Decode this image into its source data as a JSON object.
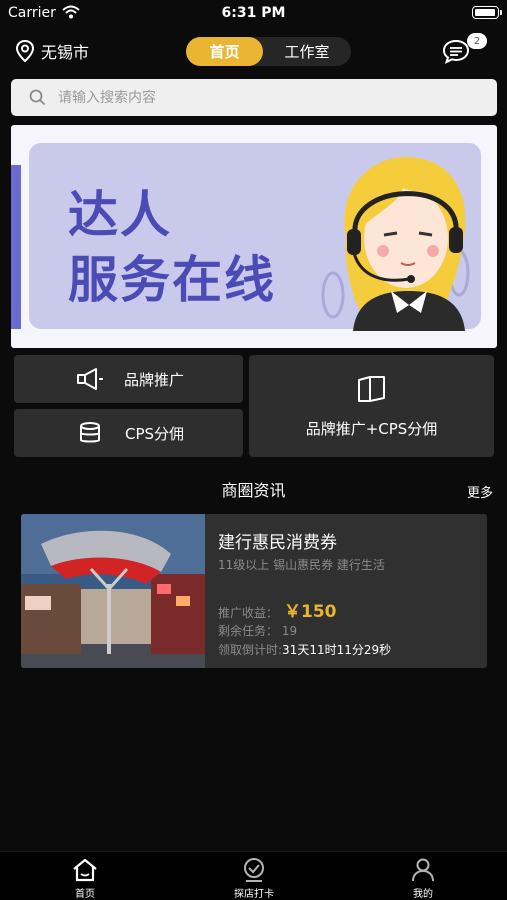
{
  "status_bar": {
    "carrier": "Carrier",
    "time": "6:31 PM"
  },
  "header": {
    "city": "无锡市",
    "tabs": [
      {
        "label": "首页",
        "active": true
      },
      {
        "label": "工作室",
        "active": false
      }
    ],
    "message_count": "2"
  },
  "search": {
    "placeholder": "请输入搜索内容"
  },
  "banner": {
    "line1": "达人",
    "line2": "服务在线"
  },
  "categories": [
    {
      "label": "品牌推广",
      "icon": "megaphone-icon"
    },
    {
      "label": "CPS分佣",
      "icon": "database-icon"
    },
    {
      "label": "品牌推广+CPS分佣",
      "icon": "book-icon"
    }
  ],
  "news": {
    "title": "商圈资讯",
    "more": "更多",
    "item": {
      "name": "建行惠民消费券",
      "tags": "11级以上 锡山惠民券 建行生活",
      "income_label": "推广收益：",
      "income_value": "￥150",
      "tasks_label": "剩余任务：",
      "tasks_value": "19",
      "countdown_label": "领取倒计时:",
      "countdown_value": "31天11时11分29秒"
    }
  },
  "tab_bar": [
    {
      "label": "首页",
      "icon": "home-icon"
    },
    {
      "label": "探店打卡",
      "icon": "checkin-icon"
    },
    {
      "label": "我的",
      "icon": "profile-icon"
    }
  ],
  "colors": {
    "accent": "#e9b532",
    "background": "#0b0b0b",
    "card": "#2e2e2e",
    "banner_text": "#4a4bb4"
  }
}
